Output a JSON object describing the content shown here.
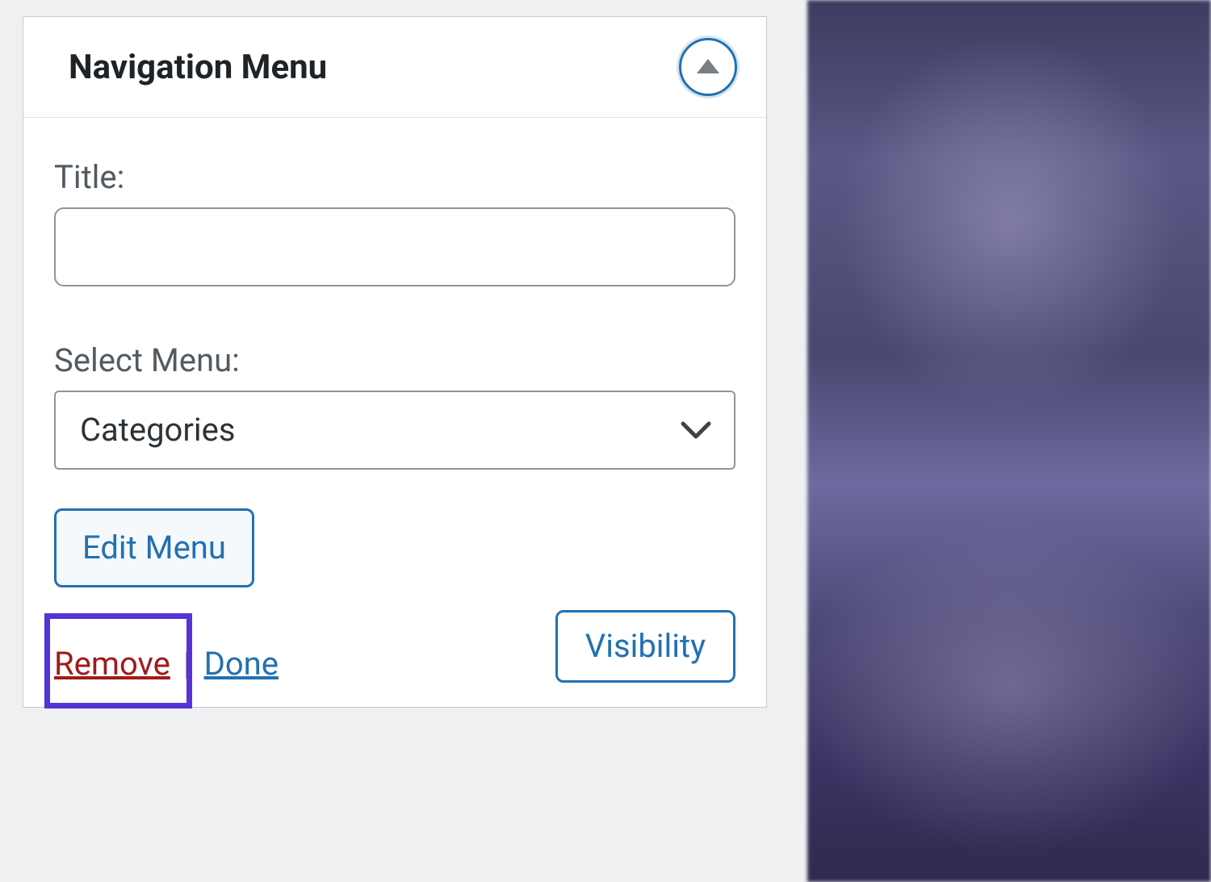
{
  "widget": {
    "title": "Navigation Menu",
    "fields": {
      "title_label": "Title:",
      "title_value": "",
      "select_menu_label": "Select Menu:",
      "select_menu_value": "Categories"
    },
    "buttons": {
      "edit_menu": "Edit Menu",
      "visibility": "Visibility"
    },
    "links": {
      "remove": "Remove",
      "done": "Done",
      "separator": "|"
    }
  },
  "colors": {
    "accent": "#2271b1",
    "danger": "#a01b1b",
    "highlight": "#5633d6"
  }
}
